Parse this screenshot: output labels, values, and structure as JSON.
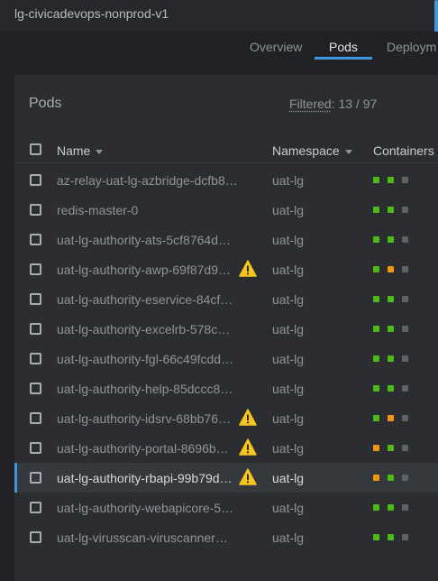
{
  "window": {
    "title": "lg-civicadevops-nonprod-v1"
  },
  "tabs": [
    {
      "label": "Overview",
      "active": false
    },
    {
      "label": "Pods",
      "active": true
    },
    {
      "label": "Deploym",
      "active": false
    }
  ],
  "panel": {
    "title": "Pods",
    "filtered_label": "Filtered",
    "filtered_value": ": 13 / 97"
  },
  "table": {
    "columns": {
      "name": "Name",
      "namespace": "Namespace",
      "containers": "Containers"
    },
    "rows": [
      {
        "name": "az-relay-uat-lg-azbridge-dcfb8…",
        "namespace": "uat-lg",
        "warning": false,
        "selected": false,
        "containers": [
          "ok",
          "ok",
          "idle"
        ]
      },
      {
        "name": "redis-master-0",
        "namespace": "uat-lg",
        "warning": false,
        "selected": false,
        "containers": [
          "ok",
          "ok",
          "idle"
        ]
      },
      {
        "name": "uat-lg-authority-ats-5cf8764d…",
        "namespace": "uat-lg",
        "warning": false,
        "selected": false,
        "containers": [
          "ok",
          "ok",
          "idle"
        ]
      },
      {
        "name": "uat-lg-authority-awp-69f87d9…",
        "namespace": "uat-lg",
        "warning": true,
        "selected": false,
        "containers": [
          "ok",
          "warn",
          "idle"
        ]
      },
      {
        "name": "uat-lg-authority-eservice-84cf…",
        "namespace": "uat-lg",
        "warning": false,
        "selected": false,
        "containers": [
          "ok",
          "ok",
          "idle"
        ]
      },
      {
        "name": "uat-lg-authority-excelrb-578c…",
        "namespace": "uat-lg",
        "warning": false,
        "selected": false,
        "containers": [
          "ok",
          "ok",
          "idle"
        ]
      },
      {
        "name": "uat-lg-authority-fgl-66c49fcdd…",
        "namespace": "uat-lg",
        "warning": false,
        "selected": false,
        "containers": [
          "ok",
          "ok",
          "idle"
        ]
      },
      {
        "name": "uat-lg-authority-help-85dccc8…",
        "namespace": "uat-lg",
        "warning": false,
        "selected": false,
        "containers": [
          "ok",
          "ok",
          "idle"
        ]
      },
      {
        "name": "uat-lg-authority-idsrv-68bb76…",
        "namespace": "uat-lg",
        "warning": true,
        "selected": false,
        "containers": [
          "ok",
          "warn",
          "idle"
        ]
      },
      {
        "name": "uat-lg-authority-portal-8696b…",
        "namespace": "uat-lg",
        "warning": true,
        "selected": false,
        "containers": [
          "warn",
          "ok",
          "idle"
        ]
      },
      {
        "name": "uat-lg-authority-rbapi-99b79d…",
        "namespace": "uat-lg",
        "warning": true,
        "selected": true,
        "containers": [
          "warn",
          "ok",
          "idle"
        ]
      },
      {
        "name": "uat-lg-authority-webapicore-5…",
        "namespace": "uat-lg",
        "warning": false,
        "selected": false,
        "containers": [
          "ok",
          "ok",
          "idle"
        ]
      },
      {
        "name": "uat-lg-virusscan-viruscanner…",
        "namespace": "uat-lg",
        "warning": false,
        "selected": false,
        "containers": [
          "ok",
          "ok",
          "idle"
        ]
      }
    ]
  },
  "colors": {
    "ok": "#4cbb17",
    "warn": "#f2950f",
    "idle": "#5e6166",
    "accent": "#3f97e0"
  },
  "icons": {
    "warning": "warning-triangle-icon",
    "sort": "sort-caret-icon",
    "checkbox": "checkbox-icon"
  }
}
